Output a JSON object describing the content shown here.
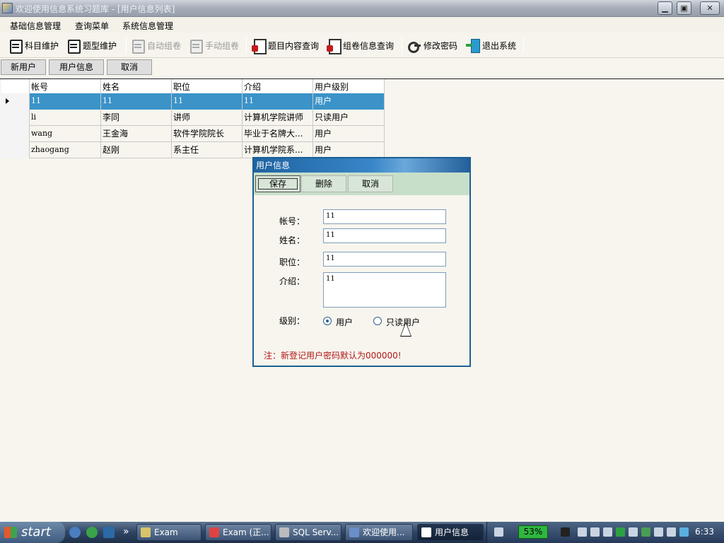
{
  "window": {
    "title": "欢迎使用信息系统习题库 - [用户信息列表]",
    "min_label": "▁",
    "max_label": "▣",
    "close_label": "✕"
  },
  "menu": [
    "基础信息管理",
    "查询菜单",
    "系统信息管理"
  ],
  "toolbar": {
    "items": [
      {
        "label": "科目维护",
        "icon": "printer-icon",
        "enabled": true
      },
      {
        "label": "题型维护",
        "icon": "printer-icon",
        "enabled": true
      },
      {
        "label": "自动组卷",
        "icon": "printer-icon",
        "enabled": false
      },
      {
        "label": "手动组卷",
        "icon": "printer-icon",
        "enabled": false
      },
      {
        "label": "题目内容查询",
        "icon": "document-search-icon",
        "enabled": true
      },
      {
        "label": "组卷信息查询",
        "icon": "document-search-icon",
        "enabled": true
      },
      {
        "label": "修改密码",
        "icon": "key-icon",
        "enabled": true
      },
      {
        "label": "退出系统",
        "icon": "exit-door-icon",
        "enabled": true
      }
    ]
  },
  "actions": {
    "new_user": "新用户",
    "user_info": "用户信息",
    "cancel": "取消"
  },
  "grid": {
    "columns": [
      "帐号",
      "姓名",
      "职位",
      "介绍",
      "用户级别"
    ],
    "rows": [
      [
        "11",
        "11",
        "11",
        "11",
        "用户"
      ],
      [
        "li",
        "李同",
        "讲师",
        "计算机学院讲师",
        "只读用户"
      ],
      [
        "wang",
        "王金海",
        "软件学院院长",
        "毕业于名牌大...",
        "用户"
      ],
      [
        "zhaogang",
        "赵刚",
        "系主任",
        "计算机学院系...",
        "用户"
      ]
    ],
    "selected_row": 0
  },
  "dialog": {
    "title": "用户信息",
    "buttons": {
      "save": "保存",
      "delete": "删除",
      "cancel": "取消"
    },
    "fields": {
      "account_label": "帐号：",
      "account_value": "11",
      "name_label": "姓名：",
      "name_value": "11",
      "position_label": "职位：",
      "position_value": "11",
      "intro_label": "介绍：",
      "intro_value": "11",
      "level_label": "级别："
    },
    "level_options": {
      "user": "用户",
      "readonly": "只读用户",
      "selected": "user"
    },
    "note": "注：新登记用户密码默认为000000!"
  },
  "taskbar": {
    "start_label": "start",
    "overflow_label": "»",
    "tasks": [
      {
        "label": "Exam",
        "active": false
      },
      {
        "label": "Exam (正...",
        "active": false
      },
      {
        "label": "SQL Serv...",
        "active": false
      },
      {
        "label": "欢迎使用...",
        "active": false
      },
      {
        "label": "用户信息",
        "active": true
      }
    ],
    "battery": "53%",
    "clock": "6:33"
  }
}
